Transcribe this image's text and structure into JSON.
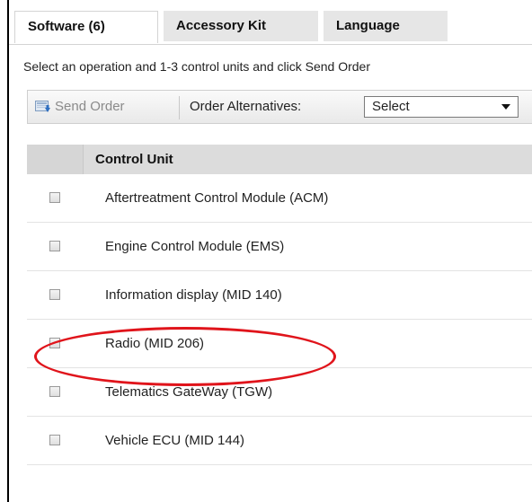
{
  "tabs": [
    {
      "label": "Software (6)",
      "active": true
    },
    {
      "label": "Accessory Kit",
      "active": false
    },
    {
      "label": "Language",
      "active": false
    }
  ],
  "instructions": "Select an operation and 1-3 control units and click Send Order",
  "toolbar": {
    "send_order_label": "Send Order",
    "send_order_icon": "send-order-icon",
    "order_alternatives_label": "Order Alternatives:",
    "order_alternatives_value": "Select"
  },
  "grid": {
    "header_label": "Control Unit",
    "rows": [
      {
        "label": "Aftertreatment Control Module (ACM)",
        "checked": false
      },
      {
        "label": "Engine Control Module (EMS)",
        "checked": false
      },
      {
        "label": "Information display (MID 140)",
        "checked": false
      },
      {
        "label": "Radio (MID 206)",
        "checked": false
      },
      {
        "label": "Telematics GateWay (TGW)",
        "checked": false
      },
      {
        "label": "Vehicle ECU (MID 144)",
        "checked": false
      }
    ]
  },
  "colors": {
    "annotation": "#e0141b",
    "tab_inactive": "#e6e6e6",
    "header_bg": "#dcdcdc"
  }
}
